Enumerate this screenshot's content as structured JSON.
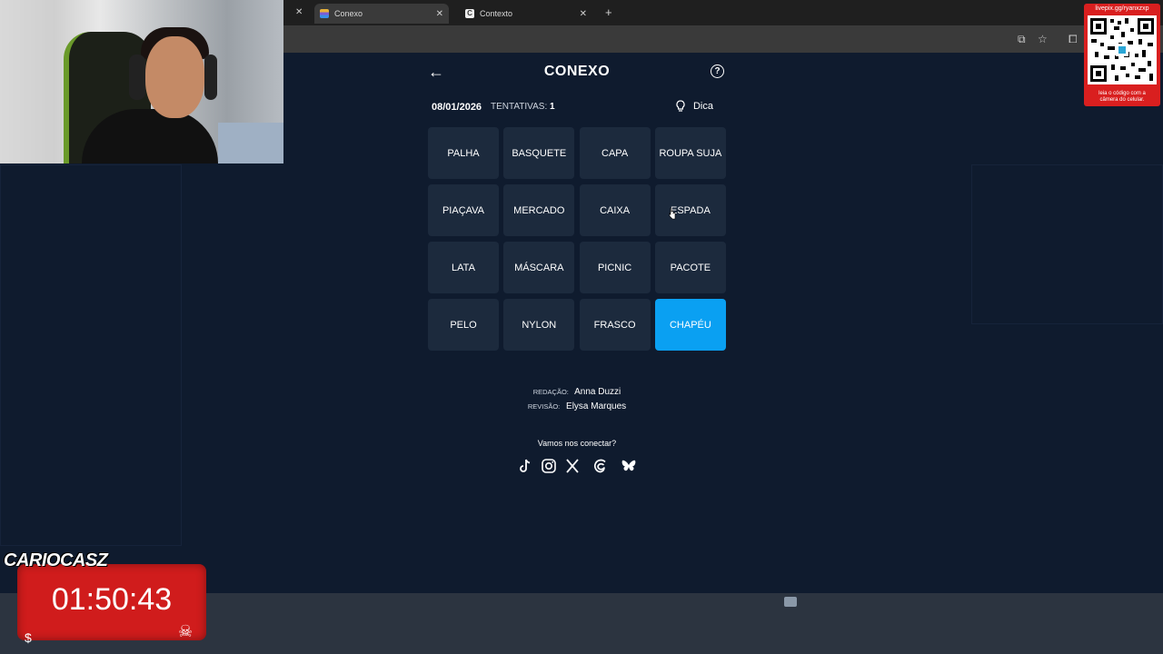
{
  "browser": {
    "tabs": [
      {
        "label": "Conexo",
        "active": true
      },
      {
        "label": "Contexto",
        "active": false
      }
    ]
  },
  "overlay": {
    "qr_url": "livepix.gg/ryanxzxp",
    "qr_caption_1": "leia o código com a",
    "qr_caption_2": "câmera do celular.",
    "streamer_name": "CARIOCASZ",
    "timer": "01:50:43"
  },
  "game": {
    "title": "CONEXO",
    "date": "08/01/2026",
    "attempts_label": "TENTATIVAS:",
    "attempts_value": "1",
    "hint_label": "Dica",
    "tiles": [
      {
        "label": "PALHA",
        "selected": false
      },
      {
        "label": "BASQUETE",
        "selected": false
      },
      {
        "label": "CAPA",
        "selected": false
      },
      {
        "label": "ROUPA SUJA",
        "selected": false
      },
      {
        "label": "PIAÇAVA",
        "selected": false
      },
      {
        "label": "MERCADO",
        "selected": false
      },
      {
        "label": "CAIXA",
        "selected": false
      },
      {
        "label": "ESPADA",
        "selected": false
      },
      {
        "label": "LATA",
        "selected": false
      },
      {
        "label": "MÁSCARA",
        "selected": false
      },
      {
        "label": "PICNIC",
        "selected": false
      },
      {
        "label": "PACOTE",
        "selected": false
      },
      {
        "label": "PELO",
        "selected": false
      },
      {
        "label": "NYLON",
        "selected": false
      },
      {
        "label": "FRASCO",
        "selected": false
      },
      {
        "label": "CHAPÉU",
        "selected": true
      }
    ],
    "credits": {
      "redacao_label": "REDAÇÃO:",
      "redacao_name": "Anna Duzzi",
      "revisao_label": "REVISÃO:",
      "revisao_name": "Elysa Marques"
    },
    "connect_label": "Vamos nos conectar?",
    "socials": [
      "tiktok-icon",
      "instagram-icon",
      "x-icon",
      "threads-icon",
      "bluesky-icon"
    ]
  },
  "colors": {
    "background": "#0f1b2e",
    "tile": "#1c2a3d",
    "tile_selected": "#0aa0f2",
    "timer": "#d01c1c"
  }
}
